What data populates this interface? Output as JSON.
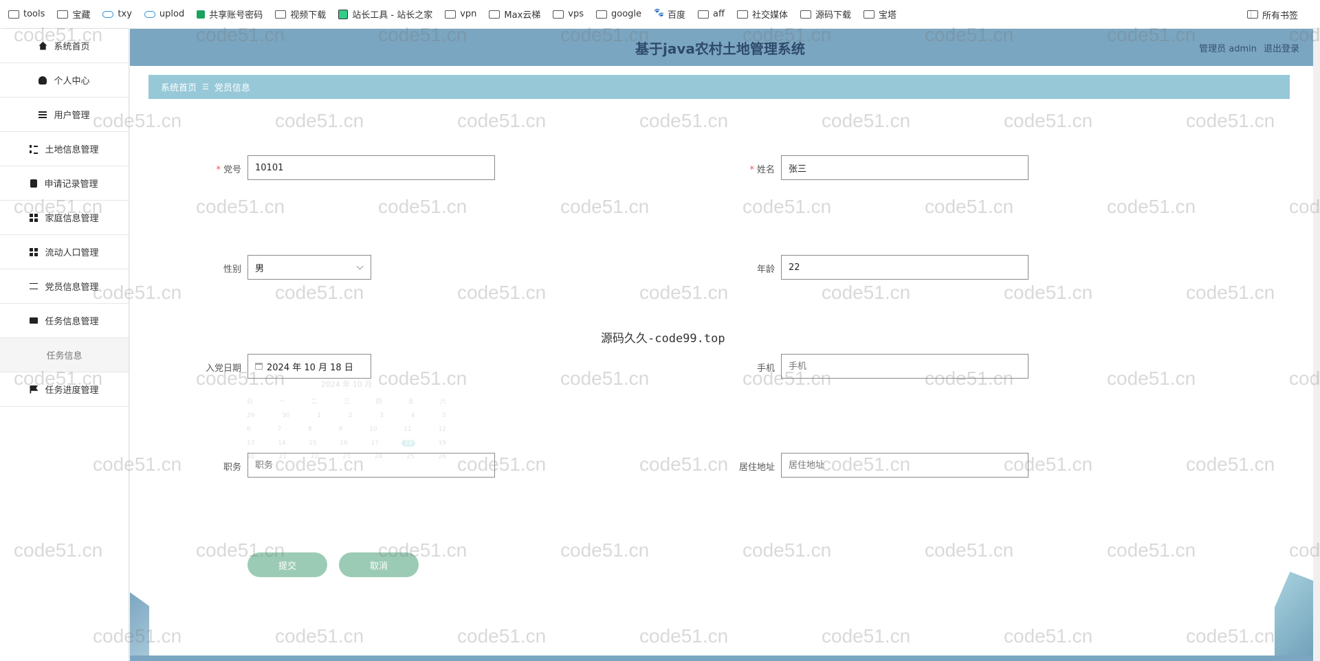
{
  "bookmarks": {
    "items": [
      "tools",
      "宝藏",
      "txy",
      "uplod",
      "共享账号密码",
      "视频下载",
      "站长工具 - 站长之家",
      "vpn",
      "Max云梯",
      "vps",
      "google",
      "百度",
      "aff",
      "社交媒体",
      "源码下载",
      "宝塔"
    ],
    "right": "所有书签"
  },
  "sidebar": {
    "items": [
      {
        "label": "系统首页",
        "icon": "home-icon"
      },
      {
        "label": "个人中心",
        "icon": "user-icon"
      },
      {
        "label": "用户管理",
        "icon": "menu-icon"
      },
      {
        "label": "土地信息管理",
        "icon": "list-icon"
      },
      {
        "label": "申请记录管理",
        "icon": "clipboard-icon"
      },
      {
        "label": "家庭信息管理",
        "icon": "grid-icon"
      },
      {
        "label": "流动人口管理",
        "icon": "grid-icon"
      },
      {
        "label": "党员信息管理",
        "icon": "sliders-icon"
      },
      {
        "label": "任务信息管理",
        "icon": "monitor-icon"
      }
    ],
    "sub_item": "任务信息",
    "last_item": {
      "label": "任务进度管理",
      "icon": "flag-icon"
    }
  },
  "header": {
    "title": "基于java农村土地管理系统",
    "user": "管理员 admin",
    "logout": "退出登录"
  },
  "breadcrumb": {
    "home": "系统首页",
    "current": "党员信息"
  },
  "form": {
    "dangid_label": "党号",
    "dangid_value": "10101",
    "name_label": "姓名",
    "name_value": "张三",
    "gender_label": "性别",
    "gender_value": "男",
    "age_label": "年龄",
    "age_value": "22",
    "join_date_label": "入党日期",
    "join_date_value": "2024 年 10 月 18 日",
    "phone_label": "手机",
    "phone_placeholder": "手机",
    "position_label": "职务",
    "position_placeholder": "职务",
    "address_label": "居住地址",
    "address_placeholder": "居住地址",
    "submit": "提交",
    "cancel": "取消"
  },
  "note": "源码久久-code99.top",
  "watermark": "code51.cn",
  "colors": {
    "header": "#7ba6c1",
    "breadcrumb": "#96c8d8",
    "button": "#9ccbb5"
  }
}
